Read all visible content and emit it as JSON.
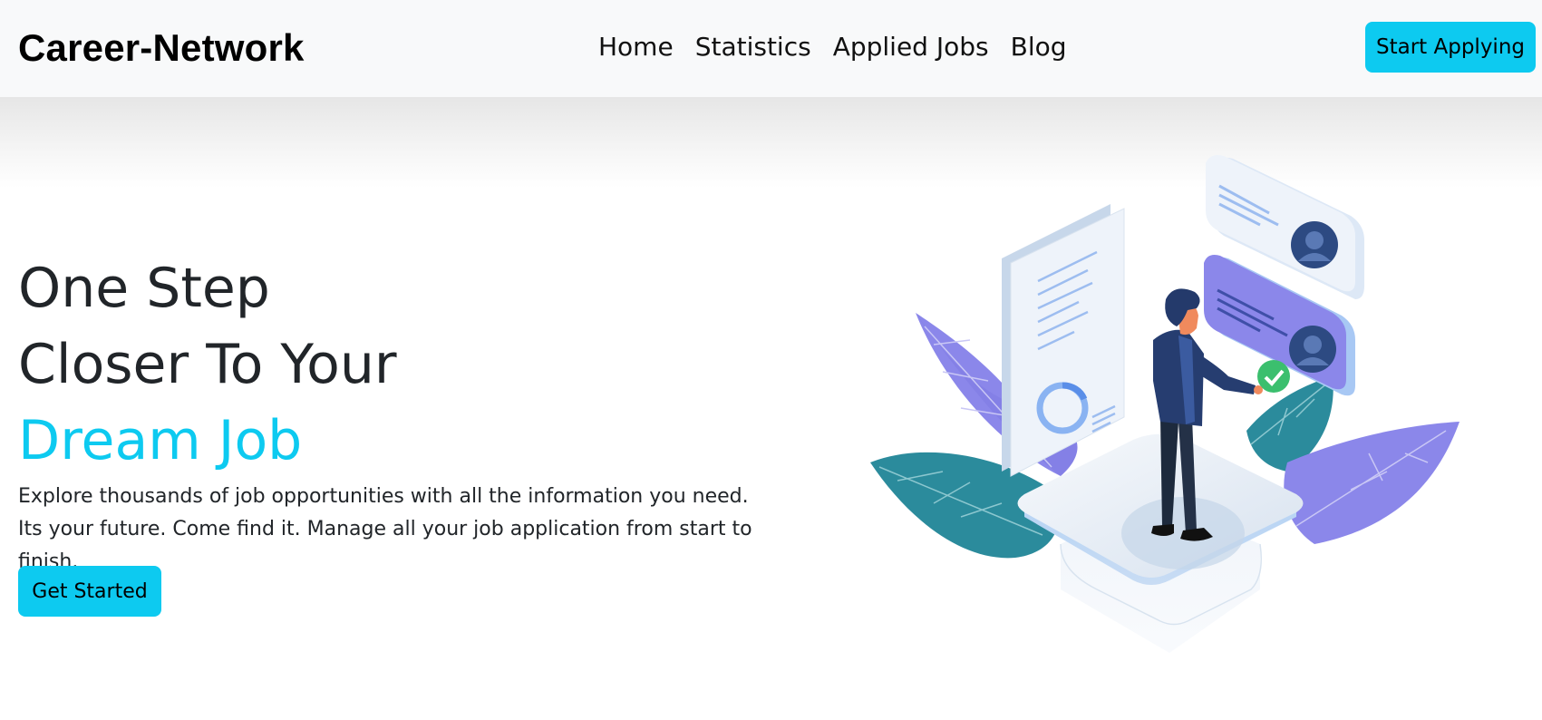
{
  "navbar": {
    "brand": "Career-Network",
    "links": [
      "Home",
      "Statistics",
      "Applied Jobs",
      "Blog"
    ],
    "cta_label": "Start Applying",
    "background": "#f8f9fa"
  },
  "hero": {
    "line1": "One Step",
    "line2": "Closer To Your",
    "line3": "Dream Job",
    "description": "Explore thousands of job opportunities with all the information you need. Its your future. Come find it. Manage all your job application from start to finish.",
    "cta_label": "Get Started"
  },
  "colors": {
    "accent": "#0dcaf0",
    "text": "#212529",
    "leaf_purple": "#8b87ea",
    "leaf_teal": "#2b8b9c",
    "suit_navy": "#243a6b"
  },
  "illustration": {
    "icon": "job-seeker-illustration"
  }
}
